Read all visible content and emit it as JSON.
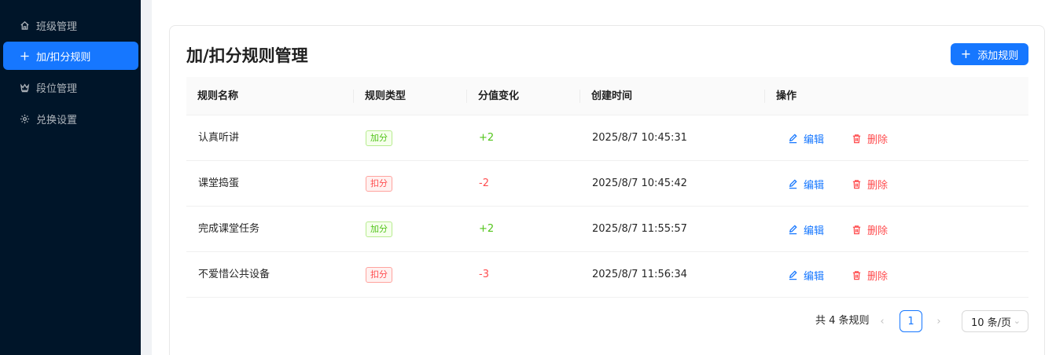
{
  "sidebar": {
    "items": [
      {
        "label": "班级管理",
        "icon": "home-icon",
        "active": false
      },
      {
        "label": "加/扣分规则",
        "icon": "plus-icon",
        "active": true
      },
      {
        "label": "段位管理",
        "icon": "crown-icon",
        "active": false
      },
      {
        "label": "兑换设置",
        "icon": "gear-icon",
        "active": false
      }
    ]
  },
  "page": {
    "title": "加/扣分规则管理",
    "add_button": "添加规则"
  },
  "table": {
    "columns": [
      "规则名称",
      "规则类型",
      "分值变化",
      "创建时间",
      "操作"
    ],
    "rows": [
      {
        "name": "认真听讲",
        "type": "加分",
        "score": "+2",
        "created": "2025/8/7 10:45:31",
        "edit": "编辑",
        "delete": "删除"
      },
      {
        "name": "课堂捣蛋",
        "type": "扣分",
        "score": "-2",
        "created": "2025/8/7 10:45:42",
        "edit": "编辑",
        "delete": "删除"
      },
      {
        "name": "完成课堂任务",
        "type": "加分",
        "score": "+2",
        "created": "2025/8/7 11:55:57",
        "edit": "编辑",
        "delete": "删除"
      },
      {
        "name": "不爱惜公共设备",
        "type": "扣分",
        "score": "-3",
        "created": "2025/8/7 11:56:34",
        "edit": "编辑",
        "delete": "删除"
      }
    ]
  },
  "pagination": {
    "total_text": "共 4 条规则",
    "current_page": "1",
    "page_size": "10 条/页"
  },
  "colors": {
    "sidebar_bg": "#001529",
    "primary": "#1677ff",
    "add_green": "#52c41a",
    "deduct_red": "#ff4d4f"
  }
}
